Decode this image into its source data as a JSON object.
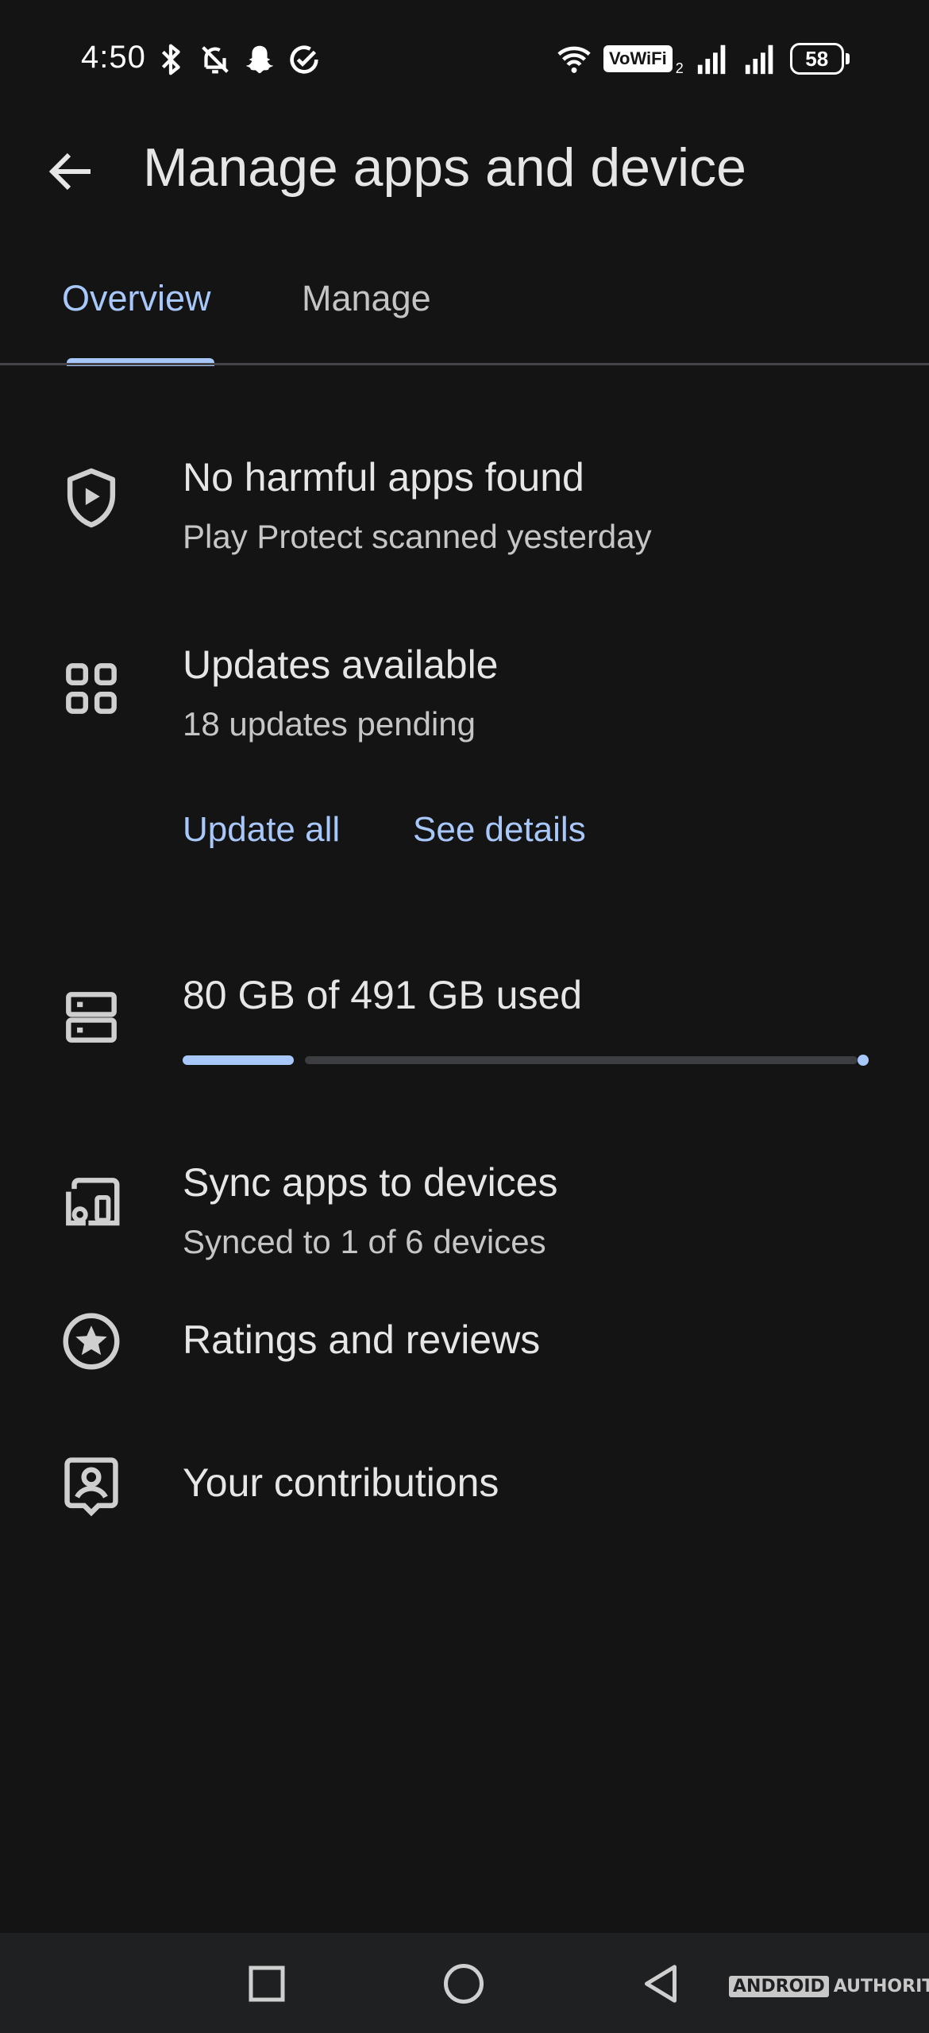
{
  "status_bar": {
    "time": "4:50",
    "vowifi": "VoWiFi",
    "vowifi_sim": "2",
    "battery": "58",
    "icons_left": [
      "bluetooth-icon",
      "notifications-off-icon",
      "snapchat-icon",
      "check-circle-icon"
    ],
    "icons_right": [
      "wifi-icon",
      "vowifi-badge",
      "signal-icon",
      "signal-icon",
      "battery-icon"
    ]
  },
  "header": {
    "title": "Manage apps and device",
    "back_icon": "arrow-back-icon"
  },
  "tabs": [
    {
      "label": "Overview",
      "selected": true
    },
    {
      "label": "Manage",
      "selected": false
    }
  ],
  "items": {
    "protect": {
      "icon": "shield-play-icon",
      "title": "No harmful apps found",
      "subtitle": "Play Protect scanned yesterday"
    },
    "updates": {
      "icon": "apps-grid-icon",
      "title": "Updates available",
      "subtitle": "18 updates pending",
      "update_all_label": "Update all",
      "see_details_label": "See details"
    },
    "storage": {
      "icon": "storage-icon",
      "title": "80 GB of 491 GB used",
      "used_gb": 80,
      "total_gb": 491
    },
    "sync": {
      "icon": "devices-icon",
      "title": "Sync apps to devices",
      "subtitle": "Synced to 1 of 6 devices"
    },
    "ratings": {
      "icon": "star-circle-icon",
      "title": "Ratings and reviews"
    },
    "contributions": {
      "icon": "person-badge-icon",
      "title": "Your contributions"
    }
  },
  "nav_bar": {
    "icons": [
      "recents-square-icon",
      "home-circle-icon",
      "back-triangle-icon"
    ]
  },
  "watermark": {
    "part1": "ANDROID",
    "part2": "AUTHORITY"
  },
  "colors": {
    "background": "#141415",
    "accent": "#a8c7fa",
    "text_primary": "#e6e6e6",
    "text_secondary": "#c6c6c6",
    "nav_bar": "#1f2022"
  }
}
